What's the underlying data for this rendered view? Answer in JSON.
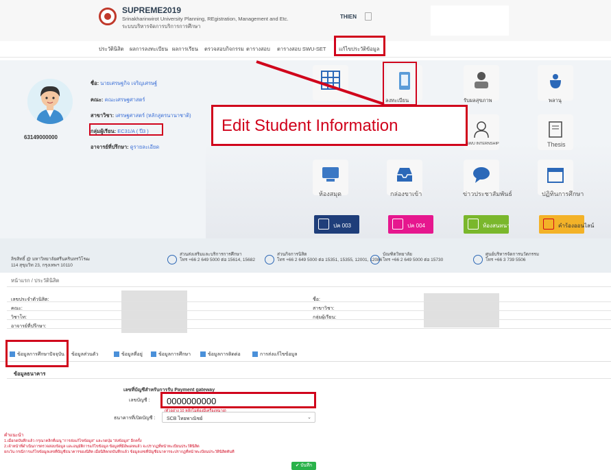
{
  "header": {
    "title": "SUPREME2019",
    "subtitle": "Srinakharinwirot University Planning, REgistration, Management and Etc.",
    "subtitle_th": "ระบบบริหารจัดการบริการการศึกษา",
    "user": "THIEN"
  },
  "nav": {
    "items": [
      "ประวัตินิสิต",
      "ผลการลงทะเบียน",
      "ผลการเรียน",
      "ตรวจสอบกิจกรรม",
      "ตารางสอบ",
      "ตารางสอบ SWU-SET",
      "แก้ไขประวัติข้อมูล"
    ]
  },
  "student": {
    "id": "63149000000",
    "name_label": "ชื่อ:",
    "name_value": "นายเศรษฐกิจ เจริญเศรษฐ์",
    "faculty_label": "คณะ:",
    "faculty_value": "คณะเศรษฐศาสตร์",
    "major_label": "สาขาวิชา:",
    "major_value": "เศรษฐศาสตร์ (หลักสูตรนานาชาติ)",
    "group_label": "กลุ่มผู้เรียน:",
    "group_value": "EC31/A ( ปี3 )",
    "advisor_label": "อาจารย์ที่ปรึกษา:",
    "advisor_value": "ดูรายละเอียด"
  },
  "callout": "Edit Student Information",
  "tiles": {
    "thesis": "Thesis",
    "internship": "SWU INTERNSHIP",
    "library": "ห้องสมุด",
    "inbox": "กล่องขาเข้า",
    "news": "ข่าวประชาสัมพันธ์",
    "calendar": "ปฏิทินการศึกษา",
    "register": "ลงทะเบียน",
    "health": "รับผลสุขภาพ",
    "apply": "พลานุ"
  },
  "pills": {
    "p003": "ปค 003",
    "p004": "ปค 004",
    "chat": "ห้องสนทนา",
    "online": "คำร้องออนไลน์"
  },
  "contact": {
    "copyright": "ลิขสิทธิ์ @ มหาวิทยาลัยศรีนครินทรวิโรฒ",
    "address": "114 สุขุมวิท 23, กรุงเทพฯ 10110",
    "c1_title": "ส่วนส่งเสริมและบริการการศึกษา",
    "c1_tel": "โทร +66 2 649 5000 ต่อ 15614, 15682",
    "c2_title": "ส่วนกิจการนิสิต",
    "c2_tel": "โทร +66 2 649 5000 ต่อ 15351, 15355, 12001, 12086",
    "c3_title": "บัณฑิตวิทยาลัย",
    "c3_tel": "โทร +66 2 649 5000 ต่อ 15730",
    "c4_title": "ศูนย์บริหารจัดการนวัตกรรม",
    "c4_tel": "โทร +66 3 739 5506"
  },
  "breadcrumb": "หน้าแรก / ประวัตินิสิต",
  "form": {
    "left_labels": [
      "เลขประจำตัวนิสิต:",
      "คณะ:",
      "วิชาโท:",
      "อาจารย์ที่ปรึกษา:"
    ],
    "right_labels": [
      "ชื่อ:",
      "สาขาวิชา:",
      "กลุ่มผู้เรียน:"
    ]
  },
  "tabs": {
    "t1": "ข้อมูลการศึกษาปัจจุบัน",
    "t2": "ข้อมูลส่วนตัว",
    "t3": "ข้อมูลที่อยู่",
    "t4": "ข้อมูลการศึกษา",
    "t5": "ข้อมูลการติดต่อ",
    "t6": "การส่งแก้ไขข้อมูล"
  },
  "bank": {
    "section": "ข้อมูลธนาคาร",
    "payment_title": "เลขที่บัญชีสำหรับการรับ Payment gateway",
    "account_label": "เลขบัญชี :",
    "account_value": "0000000000",
    "account_note": "(ตัวอย่าง 10 หลักไม่ต้องมีเครื่องหมาย)",
    "bank_label": "ธนาคารที่เปิดบัญชี :",
    "bank_value": "SCB ไทยพาณิชย์"
  },
  "instructions": {
    "title": "คำแนะนำ",
    "line1": "1.เมื่อกดบันทึกแล้ว กรุณาคลิกที่เมนู \"การส่งแก้ไขข้อมูล\" และกดปุ่ม \"ส่งข้อมูล\" อีกครั้ง",
    "line2": "2.เจ้าหน้าที่ดำเนินการตรวจสอบข้อมูล และอนุมัติการแก้ไขข้อมูล ข้อมูลที่มีอัพเดทแล้ว จะปรากฏที่หน้าทะเบียนประวัตินิสิต",
    "line3": "ยกเว้น กรณีการแก้ไขข้อมูลเลขที่บัญชีธนาคารของนิสิต เมื่อนิสิตกดบันทึกแล้ว ข้อมูลเลขที่บัญชีธนาคารจะปรากฏที่หน้าทะเบียนประวัตินิสิตทันที"
  },
  "save_label": "✔ บันทึก"
}
